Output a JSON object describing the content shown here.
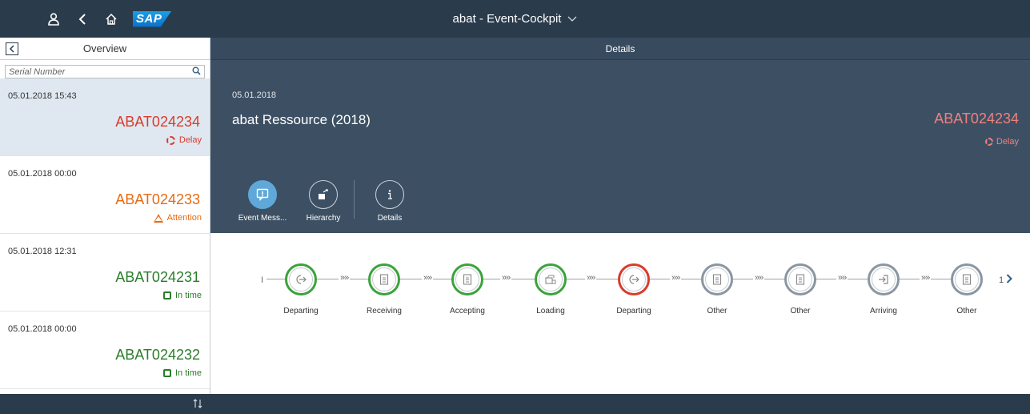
{
  "shell": {
    "title": "abat - Event-Cockpit",
    "logo": "SAP",
    "icons": [
      "person-icon",
      "back-icon",
      "home-icon"
    ]
  },
  "master": {
    "title": "Overview",
    "search_placeholder": "Serial Number",
    "items": [
      {
        "time": "05.01.2018 15:43",
        "id": "ABAT024234",
        "status": "Delay",
        "color": "#d93b2c",
        "selected": true
      },
      {
        "time": "05.01.2018 00:00",
        "id": "ABAT024233",
        "status": "Attention",
        "color": "#e76a12",
        "selected": false
      },
      {
        "time": "05.01.2018 12:31",
        "id": "ABAT024231",
        "status": "In time",
        "color": "#2b7d2b",
        "selected": false
      },
      {
        "time": "05.01.2018 00:00",
        "id": "ABAT024232",
        "status": "In time",
        "color": "#2b7d2b",
        "selected": false
      }
    ]
  },
  "details": {
    "title": "Details",
    "date": "05.01.2018",
    "object_title": "abat Ressource (2018)",
    "object_id": "ABAT024234",
    "object_status": "Delay",
    "tabs": [
      {
        "label": "Event Mess...",
        "icon": "message-alert-icon",
        "active": true
      },
      {
        "label": "Hierarchy",
        "icon": "hierarchy-icon",
        "active": false
      },
      {
        "label": "Details",
        "icon": "info-icon",
        "active": false
      }
    ],
    "flow": {
      "start_marker": "I",
      "connector_glyph": "»»",
      "nodes": [
        {
          "label": "Departing",
          "state": "green",
          "icon": "departing-icon"
        },
        {
          "label": "Receiving",
          "state": "green",
          "icon": "document-icon"
        },
        {
          "label": "Accepting",
          "state": "green",
          "icon": "document-icon"
        },
        {
          "label": "Loading",
          "state": "green",
          "icon": "loading-icon"
        },
        {
          "label": "Departing",
          "state": "red",
          "icon": "departing-icon"
        },
        {
          "label": "Other",
          "state": "grey",
          "icon": "document-icon"
        },
        {
          "label": "Other",
          "state": "grey",
          "icon": "document-icon"
        },
        {
          "label": "Arriving",
          "state": "grey",
          "icon": "arriving-icon"
        },
        {
          "label": "Other",
          "state": "grey",
          "icon": "document-icon"
        }
      ],
      "next_page_count": "1"
    }
  },
  "colors": {
    "shell": "#2a3b4c",
    "object_header": "#3d5063",
    "accent": "#5fa8d9",
    "delay": "#d93b2c",
    "attention": "#e76a12",
    "intime": "#2b7d2b"
  }
}
